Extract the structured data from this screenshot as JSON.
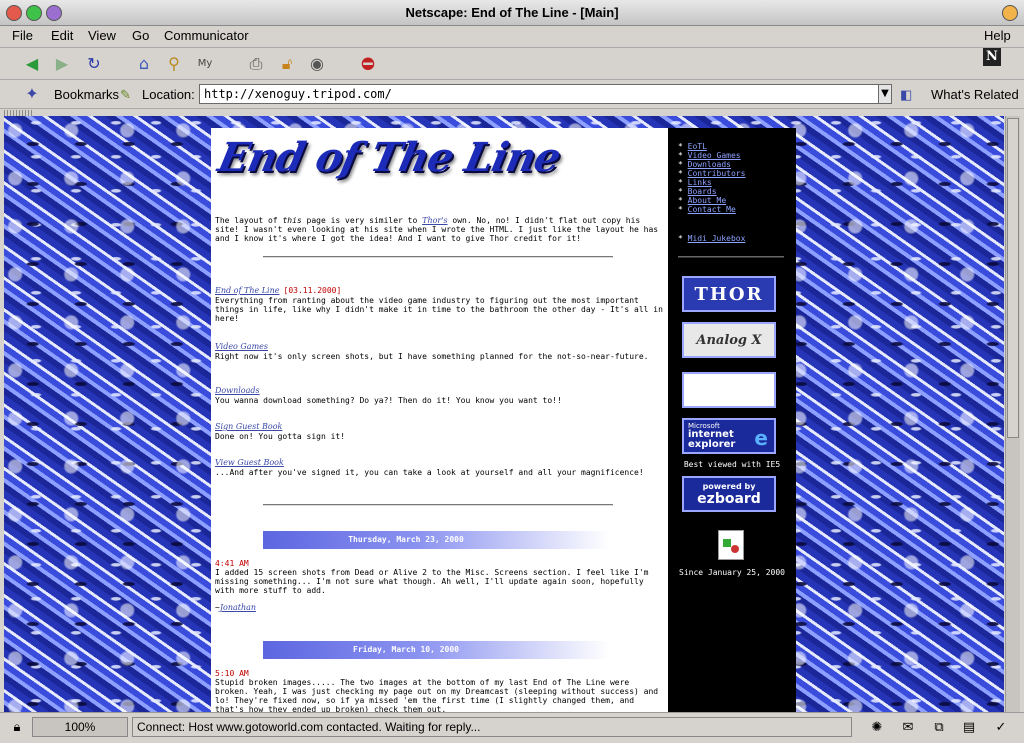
{
  "window": {
    "title": "Netscape: End of The Line - [Main]"
  },
  "menu": {
    "file": "File",
    "edit": "Edit",
    "view": "View",
    "go": "Go",
    "communicator": "Communicator",
    "help": "Help"
  },
  "location": {
    "bookmarks": "Bookmarks",
    "label": "Location:",
    "url": "http://xenoguy.tripod.com/",
    "whats_related": "What's Related"
  },
  "page": {
    "logo": "End of The Line",
    "intro": [
      {
        "t": "text",
        "v": "The layout of "
      },
      {
        "t": "em",
        "v": "this"
      },
      {
        "t": "text",
        "v": " page is very similer to "
      },
      {
        "t": "link",
        "v": "Thor's"
      },
      {
        "t": "text",
        "v": " own. No, no! I didn't flat out copy his site! I wasn't even looking at his site when I wrote the HTML. I just like the layout he has and I know it's where I got the idea! And I want to give Thor credit for it!"
      }
    ],
    "sections": [
      {
        "title": "End of The Line",
        "date": "[03.11.2000]",
        "body": "Everything from ranting about the video game industry to figuring out the most important things in life, like why I didn't make it in time to the bathroom the other day - It's all in here!"
      },
      {
        "title": "Video Games",
        "date": "",
        "body": "Right now it's only screen shots, but I have something planned for the not-so-near-future."
      },
      {
        "title": "Downloads",
        "date": "",
        "body": "You wanna download something? Do ya?! Then do it! You know you want to!!"
      },
      {
        "title": "Sign Guest Book",
        "date": "",
        "body": "Done on! You gotta sign it!"
      },
      {
        "title": "View Guest Book",
        "date": "",
        "body": "...And after you've signed it, you can take a look at yourself and all your magnificence!"
      }
    ],
    "news": [
      {
        "date": "Thursday, March 23, 2000",
        "time": "4:41 AM",
        "body": "I added 15 screen shots from Dead or Alive 2 to the Misc. Screens section. I feel like I'm missing something... I'm not sure what though. Ah well, I'll update again soon, hopefully with more stuff to add.",
        "sig": "Jonathan"
      },
      {
        "date": "Friday, March 10, 2000",
        "time": "5:10 AM",
        "body": "Stupid broken images..... The two images at the bottom of my last End of The Line were broken. Yeah, I was just checking my page out on my Dreamcast (sleeping without success) and lo! They're fixed now, so if ya missed 'em the first time (I slightly changed them, and that's how they ended up broken) check them out.",
        "sig": ""
      }
    ]
  },
  "sidebar": {
    "links": [
      "EoTL",
      "Video Games",
      "Downloads",
      "Contributors",
      "Links",
      "Boards",
      "About Me",
      "Contact Me"
    ],
    "midi": "Midi Jukebox",
    "badges": {
      "thor": "THOR",
      "analog": "Analog X",
      "ie_small": "Microsoft",
      "ie_big": "internet explorer",
      "ez_small": "powered by",
      "ez_big": "ezboard"
    },
    "best_viewed": "Best viewed with IE5",
    "since": "Since January 25, 2000"
  },
  "status": {
    "progress": "100%",
    "message": "Connect: Host www.gotoworld.com contacted. Waiting for reply..."
  }
}
